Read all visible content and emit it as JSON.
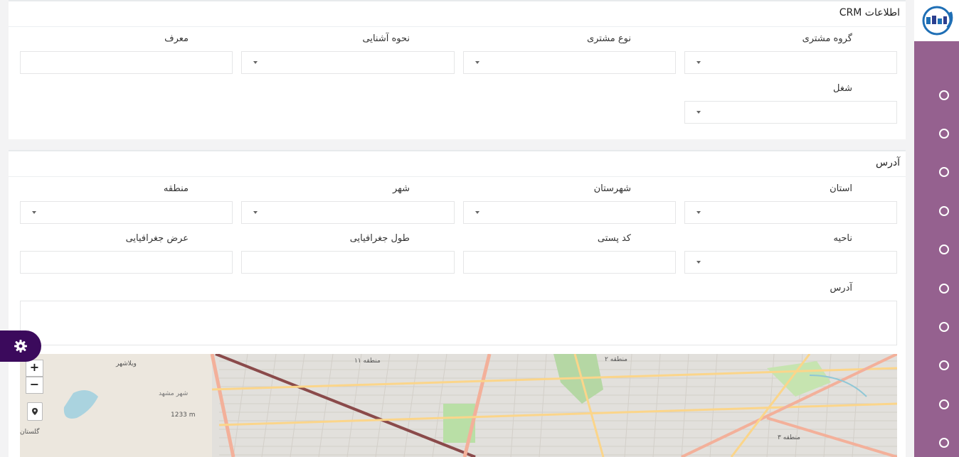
{
  "sections": {
    "crm": {
      "title": "اطلاعات CRM",
      "fields": {
        "customer_group": "گروه مشتری",
        "customer_type": "نوع مشتری",
        "acquaintance": "نحوه آشنایی",
        "referrer": "معرف",
        "job": "شغل"
      }
    },
    "address": {
      "title": "آدرس",
      "fields": {
        "province": "استان",
        "county": "شهرستان",
        "city": "شهر",
        "zone": "منطقه",
        "district": "ناحیه",
        "postal_code": "کد پستی",
        "longitude": "طول جغرافیایی",
        "latitude": "عرض جغرافیایی",
        "address": "آدرس"
      }
    }
  },
  "map": {
    "zoom_in": "+",
    "zoom_out": "−",
    "labels": {
      "zone11": "منطقه ۱۱",
      "zone2": "منطقه ۲",
      "zone3": "منطقه ۳",
      "vilashahr": "ویلاشهر",
      "shahr_mashhad": "شهر مشهد",
      "golestan": "گلستان",
      "elevation": "1233 m"
    }
  },
  "colors": {
    "sidebar": "#95618f",
    "settings_tab": "#3b0a5c"
  },
  "icons": {
    "logo": "company-logo",
    "settings": "gear-icon",
    "locate": "map-marker-icon"
  }
}
